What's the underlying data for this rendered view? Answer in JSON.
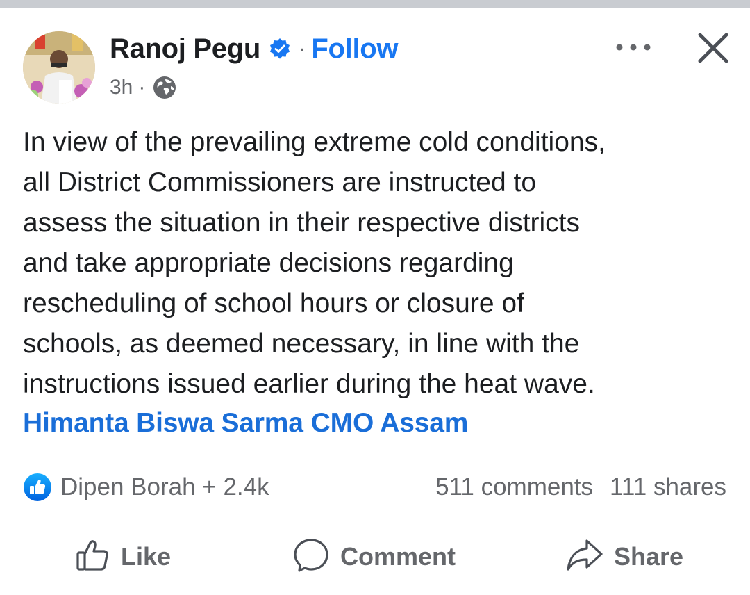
{
  "post": {
    "author": "Ranoj Pegu",
    "separator": "·",
    "follow_label": "Follow",
    "time": "3h",
    "meta_separator": "·",
    "text_lines": [
      "In view of the prevailing extreme cold conditions,",
      "all District Commissioners are instructed to",
      "assess the situation in their respective districts",
      "and take appropriate decisions regarding",
      "rescheduling of school hours or closure of",
      "schools, as deemed necessary, in line with the",
      "instructions issued earlier during the heat wave."
    ],
    "tags": [
      "Himanta Biswa Sarma",
      "CMO Assam"
    ]
  },
  "engagement": {
    "reactions": "Dipen Borah + 2.4k",
    "comments": "511 comments",
    "shares": "111 shares"
  },
  "actions": {
    "like": "Like",
    "comment": "Comment",
    "share": "Share"
  },
  "icons": {
    "verified": "verified-badge-icon",
    "audience": "globe-icon",
    "more": "more-options-icon",
    "close": "close-icon",
    "reaction": "like-reaction-icon",
    "like": "thumbs-up-icon",
    "comment": "comment-bubble-icon",
    "share": "share-arrow-icon"
  },
  "colors": {
    "accent": "#1877f2",
    "text": "#1c1e21",
    "secondary_text": "#65676b",
    "tag": "#1a6ed8",
    "top_strip": "#c9ccd1"
  }
}
